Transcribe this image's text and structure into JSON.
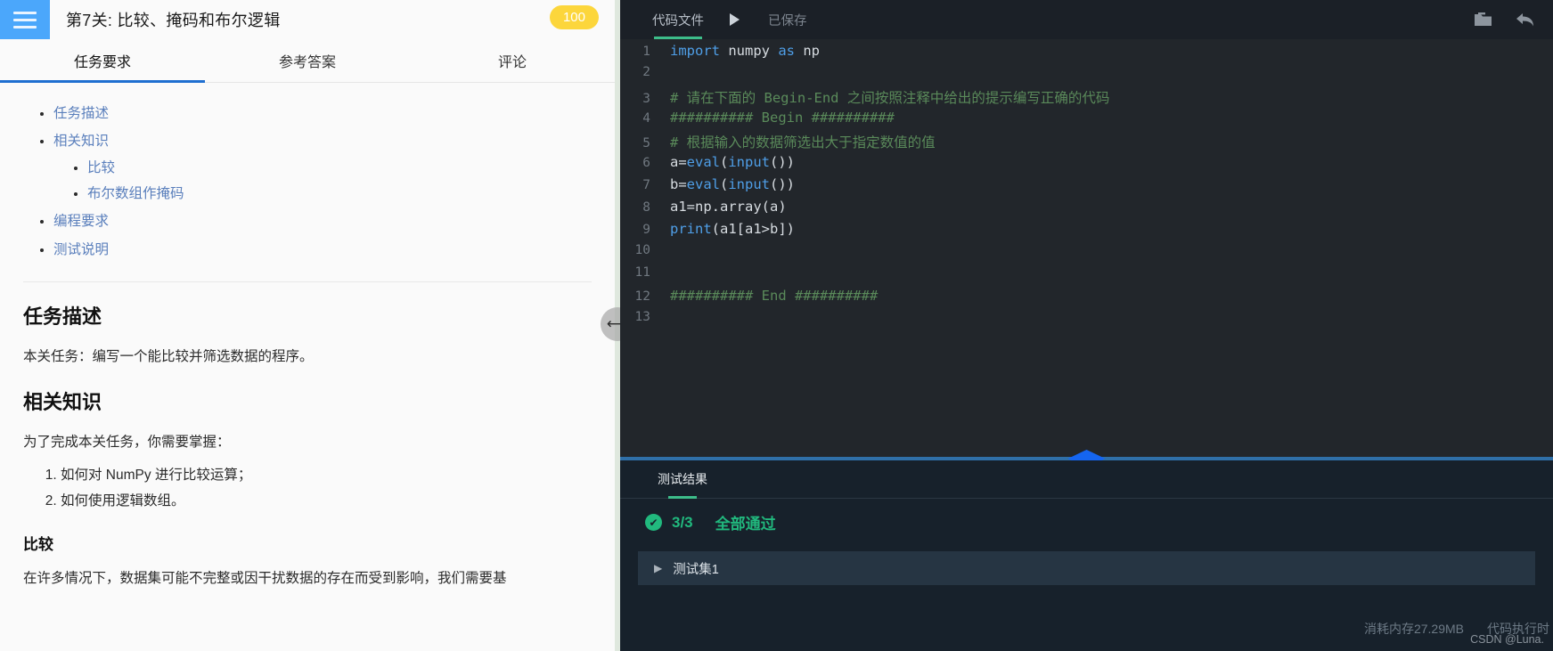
{
  "left": {
    "header": {
      "menu_icon": "hamburger-icon",
      "title": "第7关: 比较、掩码和布尔逻辑",
      "score": "100"
    },
    "tabs": [
      {
        "label": "任务要求",
        "active": true
      },
      {
        "label": "参考答案",
        "active": false
      },
      {
        "label": "评论",
        "active": false
      }
    ],
    "toc": [
      {
        "label": "任务描述"
      },
      {
        "label": "相关知识",
        "children": [
          {
            "label": "比较"
          },
          {
            "label": "布尔数组作掩码"
          }
        ]
      },
      {
        "label": "编程要求"
      },
      {
        "label": "测试说明"
      }
    ],
    "sections": {
      "task_heading": "任务描述",
      "task_text": "本关任务：编写一个能比较并筛选数据的程序。",
      "knowledge_heading": "相关知识",
      "knowledge_intro": "为了完成本关任务，你需要掌握：",
      "knowledge_items": [
        "如何对 NumPy 进行比较运算；",
        "如何使用逻辑数组。"
      ],
      "compare_heading": "比较",
      "compare_text": "在许多情况下，数据集可能不完整或因干扰数据的存在而受到影响，我们需要基"
    }
  },
  "splitter": {
    "horizontal_resize_icon": "horizontal-resize-icon",
    "vertical_resize_icon": "vertical-resize-handle-icon"
  },
  "right": {
    "toolbar": {
      "file_tab": "代码文件",
      "run_icon": "play-icon",
      "save_state": "已保存",
      "folder_icon": "folder-icon",
      "undo_icon": "undo-arrow-icon"
    },
    "code": [
      {
        "n": "1",
        "tokens": [
          {
            "t": "import",
            "c": "kw"
          },
          {
            "t": " numpy ",
            "c": "plain"
          },
          {
            "t": "as",
            "c": "kw"
          },
          {
            "t": " np",
            "c": "plain"
          }
        ]
      },
      {
        "n": "2",
        "tokens": []
      },
      {
        "n": "3",
        "tokens": [
          {
            "t": "# 请在下面的 Begin-End 之间按照注释中给出的提示编写正确的代码",
            "c": "com"
          }
        ]
      },
      {
        "n": "4",
        "tokens": [
          {
            "t": "########## Begin ##########",
            "c": "com"
          }
        ]
      },
      {
        "n": "5",
        "tokens": [
          {
            "t": "# 根据输入的数据筛选出大于指定数值的值",
            "c": "com"
          }
        ]
      },
      {
        "n": "6",
        "tokens": [
          {
            "t": "a=",
            "c": "plain"
          },
          {
            "t": "eval",
            "c": "fn"
          },
          {
            "t": "(",
            "c": "plain"
          },
          {
            "t": "input",
            "c": "fn"
          },
          {
            "t": "())",
            "c": "plain"
          }
        ]
      },
      {
        "n": "7",
        "tokens": [
          {
            "t": "b=",
            "c": "plain"
          },
          {
            "t": "eval",
            "c": "fn"
          },
          {
            "t": "(",
            "c": "plain"
          },
          {
            "t": "input",
            "c": "fn"
          },
          {
            "t": "())",
            "c": "plain"
          }
        ]
      },
      {
        "n": "8",
        "tokens": [
          {
            "t": "a1=np.array(a)",
            "c": "plain"
          }
        ]
      },
      {
        "n": "9",
        "tokens": [
          {
            "t": "print",
            "c": "fn"
          },
          {
            "t": "(a1[a1>b])",
            "c": "plain"
          }
        ]
      },
      {
        "n": "10",
        "tokens": []
      },
      {
        "n": "11",
        "tokens": []
      },
      {
        "n": "12",
        "tokens": [
          {
            "t": "########## End ##########",
            "c": "com"
          }
        ]
      },
      {
        "n": "13",
        "tokens": []
      }
    ],
    "results": {
      "tab": "测试结果",
      "check_icon": "check-circle-icon",
      "pass_count": "3/3",
      "pass_label": "全部通过",
      "testset_caret_icon": "caret-right-icon",
      "testset_label": "测试集1",
      "memory": "消耗内存27.29MB",
      "exec_time": "代码执行时",
      "watermark": "CSDN @Luna."
    }
  },
  "colors": {
    "accent_blue": "#4ba7fb",
    "badge_yellow": "#fcd63c",
    "tab_underline": "#1f6fd0",
    "editor_bg": "#22262b",
    "pass_green": "#21b97e",
    "green_underline": "#3dbd8a"
  }
}
